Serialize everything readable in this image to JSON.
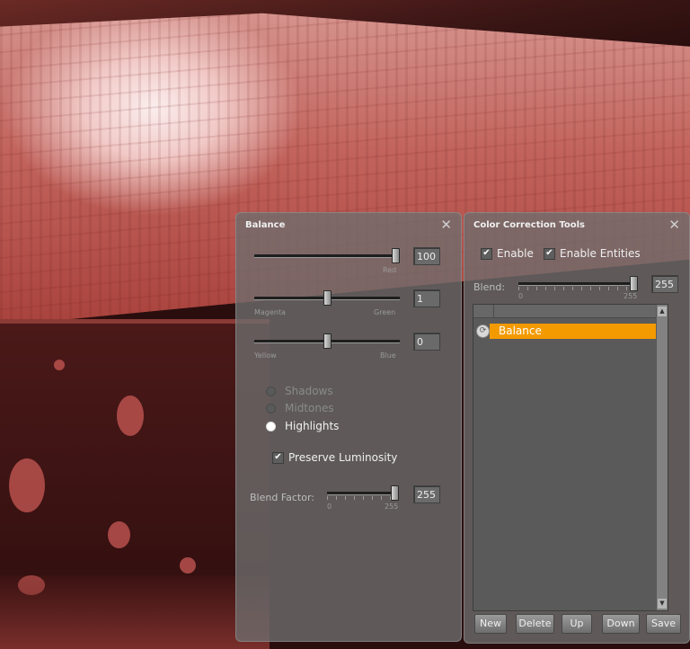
{
  "balance_panel": {
    "title": "Balance",
    "close_glyph": "✕",
    "sliders": [
      {
        "value": "100",
        "left_label": "",
        "right_label": "Red",
        "level": 1.0
      },
      {
        "value": "1",
        "left_label": "Magenta",
        "right_label": "Green",
        "level": 0.5
      },
      {
        "value": "0",
        "left_label": "Yellow",
        "right_label": "Blue",
        "level": 0.5
      }
    ],
    "tones": [
      {
        "label": "Shadows",
        "selected": false
      },
      {
        "label": "Midtones",
        "selected": false
      },
      {
        "label": "Highlights",
        "selected": true
      }
    ],
    "preserve_luminosity": {
      "label": "Preserve Luminosity",
      "checked": true
    },
    "blend_factor": {
      "label": "Blend Factor:",
      "value": "255",
      "min_label": "0",
      "max_label": "255",
      "level": 1.0
    }
  },
  "cct_panel": {
    "title": "Color Correction Tools",
    "close_glyph": "✕",
    "enable": {
      "label": "Enable",
      "checked": true
    },
    "enable_entities": {
      "label": "Enable Entities",
      "checked": true
    },
    "blend": {
      "label": "Blend:",
      "value": "255",
      "min_label": "0",
      "max_label": "255",
      "level": 1.0
    },
    "list_items": [
      {
        "label": "Balance",
        "selected": true
      }
    ],
    "buttons": {
      "new": "New",
      "delete": "Delete",
      "up": "Up",
      "down": "Down",
      "save": "Save"
    }
  },
  "colors": {
    "selection": "#f39a00",
    "panel_bg": "#6e6e6e",
    "scene_tint": "#c2645d"
  }
}
